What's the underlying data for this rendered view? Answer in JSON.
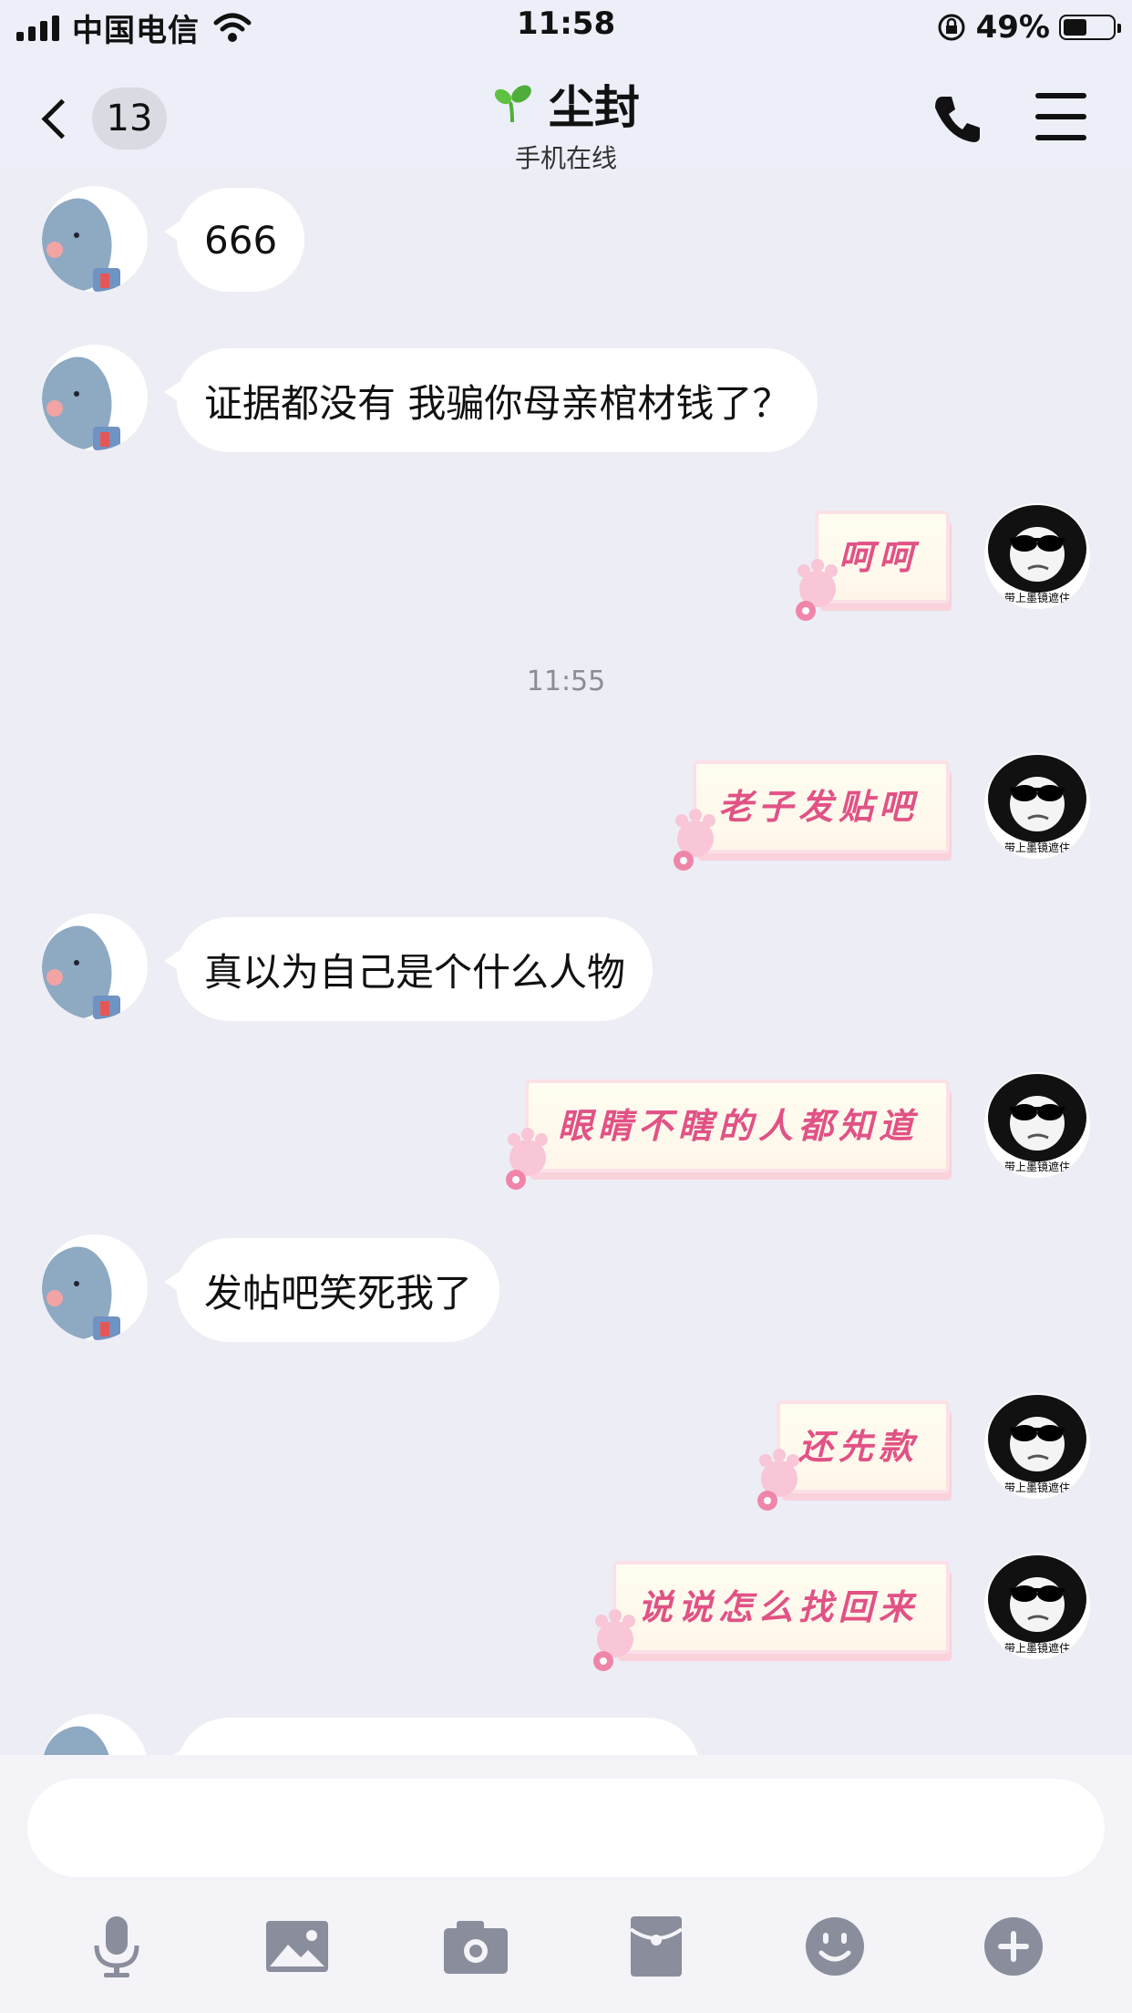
{
  "status_bar": {
    "carrier": "中国电信",
    "time": "11:58",
    "battery_percent": "49%",
    "battery_level": 0.49
  },
  "nav": {
    "unread_count": "13",
    "title": "尘封",
    "subtitle": "手机在线",
    "icons": [
      "back-chevron-icon",
      "sprout-icon",
      "phone-icon",
      "menu-icon"
    ]
  },
  "messages": [
    {
      "side": "left",
      "type": "text",
      "text": "666"
    },
    {
      "side": "left",
      "type": "text",
      "text": "证据都没有  我骗你母亲棺材钱了？"
    },
    {
      "side": "right",
      "type": "sticker",
      "text": "呵呵"
    },
    {
      "type": "timestamp",
      "text": "11:55"
    },
    {
      "side": "right",
      "type": "sticker",
      "text": "老子发贴吧"
    },
    {
      "side": "left",
      "type": "text",
      "text": "真以为自己是个什么人物"
    },
    {
      "side": "right",
      "type": "sticker",
      "text": "眼睛不瞎的人都知道"
    },
    {
      "side": "left",
      "type": "text",
      "text": "发帖吧笑死我了"
    },
    {
      "side": "right",
      "type": "sticker",
      "text": "还先款"
    },
    {
      "side": "right",
      "type": "sticker",
      "text": "说说怎么找回来"
    }
  ],
  "right_avatar_caption": "带上墨镜遮住",
  "composer": {
    "input_value": "",
    "tools": [
      "microphone-icon",
      "image-icon",
      "camera-icon",
      "red-packet-icon",
      "emoji-icon",
      "plus-icon"
    ]
  },
  "colors": {
    "background": "#ededf5",
    "bubble": "#ffffff",
    "sticker_text": "#e15285",
    "avatar_blue": "#8ea9c2"
  }
}
